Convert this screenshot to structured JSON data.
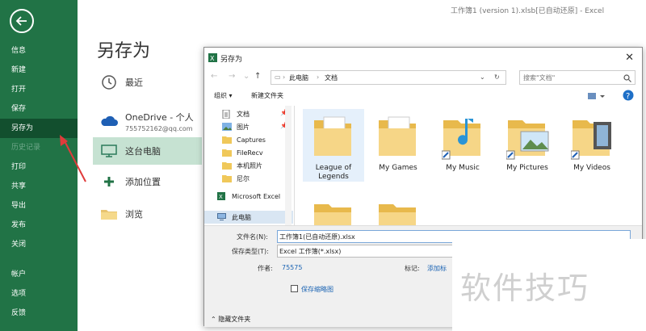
{
  "window": {
    "title": "工作簿1 (version 1).xlsb[已自动还原] - Excel"
  },
  "left_nav": {
    "items": [
      {
        "label": "信息"
      },
      {
        "label": "新建"
      },
      {
        "label": "打开"
      },
      {
        "label": "保存"
      },
      {
        "label": "另存为",
        "active": true
      },
      {
        "label": "历史记录",
        "disabled": true
      },
      {
        "label": "打印"
      },
      {
        "label": "共享"
      },
      {
        "label": "导出"
      },
      {
        "label": "发布"
      },
      {
        "label": "关闭"
      },
      {
        "label": "帐户"
      },
      {
        "label": "选项"
      },
      {
        "label": "反馈"
      }
    ]
  },
  "backstage": {
    "heading": "另存为",
    "locations": [
      {
        "label": "最近",
        "icon": "clock-icon"
      },
      {
        "label": "OneDrive - 个人",
        "sub": "755752162@qq.com",
        "icon": "cloud-icon"
      },
      {
        "label": "这台电脑",
        "icon": "computer-icon",
        "selected": true
      },
      {
        "label": "添加位置",
        "icon": "plus-icon"
      },
      {
        "label": "浏览",
        "icon": "folder-icon"
      }
    ]
  },
  "dialog": {
    "title": "另存为",
    "address": {
      "root": "此电脑",
      "folder": "文档"
    },
    "search_placeholder": "搜索\"文档\"",
    "toolbar": {
      "organize": "组织 ▾",
      "new_folder": "新建文件夹"
    },
    "tree": [
      {
        "label": "文档",
        "icon": "document-icon",
        "pinned": true
      },
      {
        "label": "图片",
        "icon": "picture-icon",
        "pinned": true
      },
      {
        "label": "Captures",
        "icon": "folder-icon"
      },
      {
        "label": "FileRecv",
        "icon": "folder-icon"
      },
      {
        "label": "本机照片",
        "icon": "folder-icon"
      },
      {
        "label": "尼尔",
        "icon": "folder-icon"
      },
      {
        "label": "Microsoft Excel",
        "icon": "excel-icon"
      },
      {
        "label": "此电脑",
        "icon": "computer-icon",
        "selected": true
      }
    ],
    "files": [
      {
        "name": "League of Legends",
        "selected": true
      },
      {
        "name": "My Games"
      },
      {
        "name": "My Music"
      },
      {
        "name": "My Pictures"
      },
      {
        "name": "My Videos"
      }
    ],
    "form": {
      "filename_label": "文件名(N):",
      "filename": "工作簿1(已自动还原).xlsx",
      "filetype_label": "保存类型(T):",
      "filetype": "Excel 工作簿(*.xlsx)",
      "author_label": "作者:",
      "author": "75575",
      "tags_label": "标记:",
      "tags_link": "添加标",
      "thumbnail_label": "保存缩略图",
      "hide_folders": "隐藏文件夹"
    }
  },
  "watermark": "软件技巧"
}
